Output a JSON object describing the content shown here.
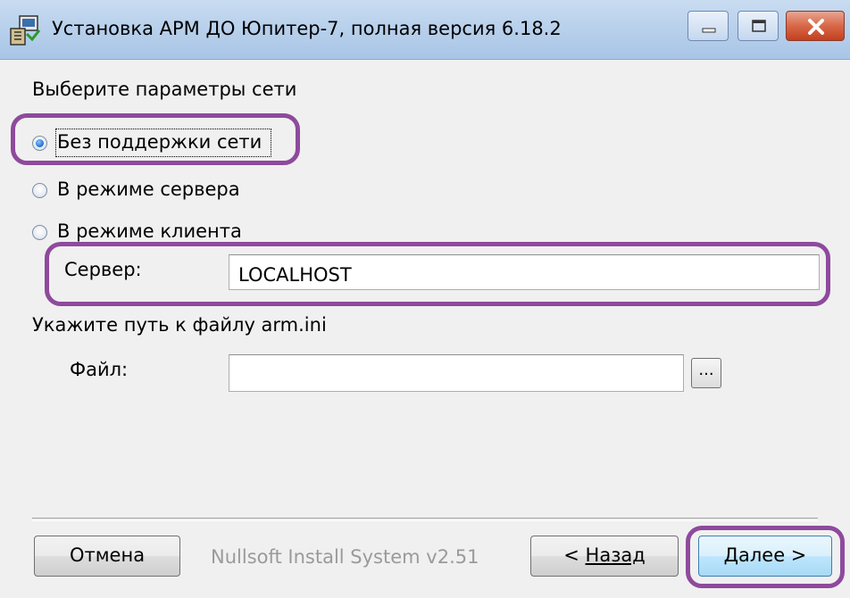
{
  "window": {
    "title": "Установка АРМ ДО Юпитер-7, полная версия 6.18.2"
  },
  "heading": "Выберите параметры сети",
  "network_options": [
    {
      "label": "Без поддержки сети",
      "selected": true
    },
    {
      "label": "В режиме сервера",
      "selected": false
    },
    {
      "label": "В режиме клиента",
      "selected": false
    }
  ],
  "server": {
    "label": "Сервер:",
    "value": "LOCALHOST"
  },
  "ini_path": {
    "prompt": "Укажите путь к файлу arm.ini",
    "label": "Файл:",
    "value": "",
    "browse_label": "..."
  },
  "footer": {
    "cancel_label": "Отмена",
    "branding": "Nullsoft Install System v2.51",
    "back_prefix": "< ",
    "back_label": "Назад",
    "next_label": "Далее >"
  },
  "colors": {
    "annotation": "#8e4a9c",
    "titlebar": "#b9d1ec",
    "close": "#c2401f"
  }
}
